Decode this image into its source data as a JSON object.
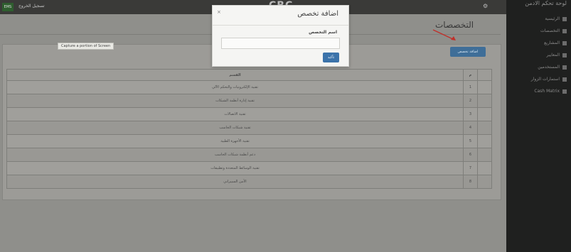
{
  "topbar": {
    "left_button": "EMS",
    "register_link": "تسجيل الخروج",
    "logo": "CBC"
  },
  "sidebar": {
    "title": "لوحة تحكم الادمن",
    "items": [
      {
        "label": "الرئيسية"
      },
      {
        "label": "التخصصات"
      },
      {
        "label": "المشاريع"
      },
      {
        "label": "المعايير"
      },
      {
        "label": "المستخدمين"
      },
      {
        "label": "استمارات الزوار"
      },
      {
        "label": "Cash Matrix"
      }
    ]
  },
  "page": {
    "title": "التخصصات",
    "add_button": "اضافة تخصص",
    "tooltip": "Capture a portion of Screen"
  },
  "table": {
    "headers": {
      "idx": "",
      "num": "م",
      "name": "القسم"
    },
    "rows": [
      {
        "num": "1",
        "name": "تقنية الإلكترونيات والتحكم الآلي"
      },
      {
        "num": "2",
        "name": "تقنية إدارة أنظمة الشبكات"
      },
      {
        "num": "3",
        "name": "تقنية الاتصالات"
      },
      {
        "num": "4",
        "name": "تقنية شبكات الحاسب"
      },
      {
        "num": "5",
        "name": "تقنية الأجهزة الطبية"
      },
      {
        "num": "6",
        "name": "دعم أنظمة شبكات الحاسب"
      },
      {
        "num": "7",
        "name": "تقنية الوسائط المتعددة وتطبيقات"
      },
      {
        "num": "8",
        "name": "الأمن السيبراني"
      }
    ]
  },
  "modal": {
    "title": "اضافة تخصص",
    "field_label": "اسم التخصص",
    "field_value": "",
    "field_placeholder": "",
    "submit_label": "تأكيد",
    "close_label": "×"
  },
  "colors": {
    "accent": "#3f6e98",
    "sidebar_bg": "#1f201f",
    "arrow": "#c0302a"
  }
}
